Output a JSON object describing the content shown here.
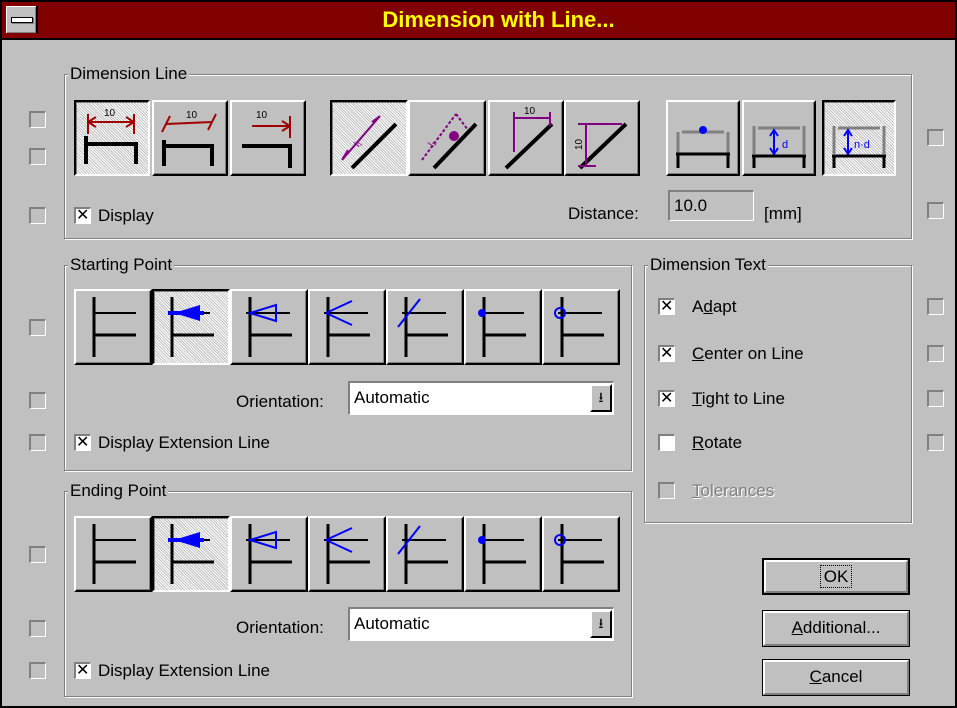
{
  "window": {
    "title": "Dimension with Line..."
  },
  "dimension_line": {
    "legend": "Dimension Line",
    "display": {
      "label": "Display",
      "checked": true
    },
    "distance": {
      "label": "Distance:",
      "value": "10.0",
      "unit": "[mm]"
    },
    "style_values": [
      "10",
      "10",
      "10"
    ],
    "dim_values": [
      "10",
      "10"
    ],
    "offset_labels": [
      "d",
      "n·d"
    ]
  },
  "starting_point": {
    "legend": "Starting Point",
    "orientation": {
      "label": "Orientation:",
      "value": "Automatic"
    },
    "ext_line": {
      "label": "Display Extension Line",
      "checked": true
    }
  },
  "ending_point": {
    "legend": "Ending Point",
    "orientation": {
      "label": "Orientation:",
      "value": "Automatic"
    },
    "ext_line": {
      "label": "Display Extension Line",
      "checked": true
    }
  },
  "dimension_text": {
    "legend": "Dimension Text",
    "options": [
      {
        "pre": "A",
        "u": "d",
        "post": "apt",
        "checked": true,
        "enabled": true
      },
      {
        "pre": "",
        "u": "C",
        "post": "enter on Line",
        "checked": true,
        "enabled": true
      },
      {
        "pre": "",
        "u": "T",
        "post": "ight to Line",
        "checked": true,
        "enabled": true
      },
      {
        "pre": "",
        "u": "R",
        "post": "otate",
        "checked": false,
        "enabled": true
      },
      {
        "pre": "",
        "u": "T",
        "post": "olerances",
        "checked": false,
        "enabled": false
      }
    ]
  },
  "buttons": {
    "ok": "OK",
    "additional_u": "A",
    "additional_rest": "dditional...",
    "cancel_u": "C",
    "cancel_rest": "ancel"
  },
  "colors": {
    "title_bg": "#800000",
    "title_fg": "#ffff00",
    "face": "#c0c0c0",
    "accent_red": "#a00000",
    "accent_purple": "#800080",
    "accent_blue": "#0000ff"
  }
}
